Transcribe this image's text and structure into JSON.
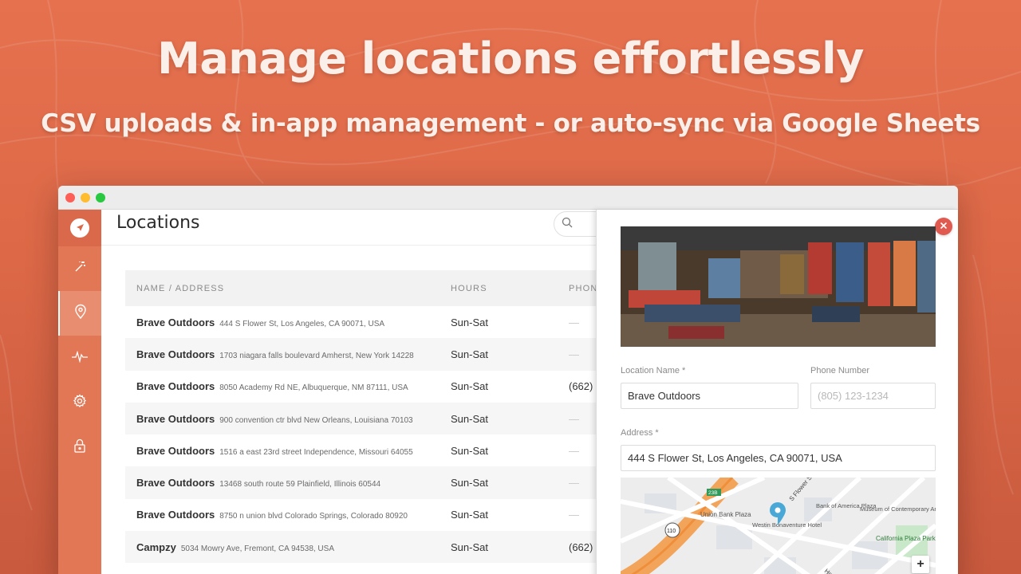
{
  "banner": {
    "headline": "Manage locations effortlessly",
    "subhead": "CSV uploads & in-app management - or auto-sync via Google Sheets"
  },
  "colors": {
    "background": "#e26d4c",
    "sidebar": "#e27755",
    "accent": "#e05a50"
  },
  "sidebar": {
    "logo_icon": "navigation-arrow-icon",
    "items": [
      {
        "icon": "magic-wand-icon",
        "active": false
      },
      {
        "icon": "location-pin-icon",
        "active": true
      },
      {
        "icon": "activity-pulse-icon",
        "active": false
      },
      {
        "icon": "gear-icon",
        "active": false
      },
      {
        "icon": "lock-icon",
        "active": false
      }
    ]
  },
  "main": {
    "title": "Locations",
    "search_icon": "search-icon",
    "table": {
      "columns": [
        "NAME / ADDRESS",
        "HOURS",
        "PHONE"
      ],
      "rows": [
        {
          "name": "Brave Outdoors",
          "address": "444 S Flower St, Los Angeles, CA 90071, USA",
          "hours": "Sun-Sat",
          "phone": "—"
        },
        {
          "name": "Brave Outdoors",
          "address": "1703 niagara falls boulevard Amherst, New York 14228",
          "hours": "Sun-Sat",
          "phone": "—"
        },
        {
          "name": "Brave Outdoors",
          "address": "8050 Academy Rd NE, Albuquerque, NM 87111, USA",
          "hours": "Sun-Sat",
          "phone": "(662)"
        },
        {
          "name": "Brave Outdoors",
          "address": "900 convention ctr blvd New Orleans, Louisiana 70103",
          "hours": "Sun-Sat",
          "phone": "—"
        },
        {
          "name": "Brave Outdoors",
          "address": "1516 a east 23rd street Independence, Missouri 64055",
          "hours": "Sun-Sat",
          "phone": "—"
        },
        {
          "name": "Brave Outdoors",
          "address": "13468 south route 59 Plainfield, Illinois 60544",
          "hours": "Sun-Sat",
          "phone": "—"
        },
        {
          "name": "Brave Outdoors",
          "address": "8750 n union blvd Colorado Springs, Colorado 80920",
          "hours": "Sun-Sat",
          "phone": "—"
        },
        {
          "name": "Campzy",
          "address": "5034 Mowry Ave, Fremont, CA 94538, USA",
          "hours": "Sun-Sat",
          "phone": "(662)"
        }
      ]
    }
  },
  "panel": {
    "close_icon": "close-icon",
    "location_name_label": "Location Name *",
    "location_name_value": "Brave Outdoors",
    "phone_label": "Phone Number",
    "phone_placeholder": "(805) 123-1234",
    "address_label": "Address *",
    "address_value": "444 S Flower St, Los Angeles, CA 90071, USA",
    "map": {
      "labels": [
        "Union Bank Plaza",
        "Bank of America Plaza",
        "Museum of Contemporary Art",
        "California Plaza Park",
        "Westin Bonaventure Hotel",
        "S Flower St",
        "Hope St",
        "110",
        "23B"
      ],
      "zoom_in": "+"
    }
  }
}
